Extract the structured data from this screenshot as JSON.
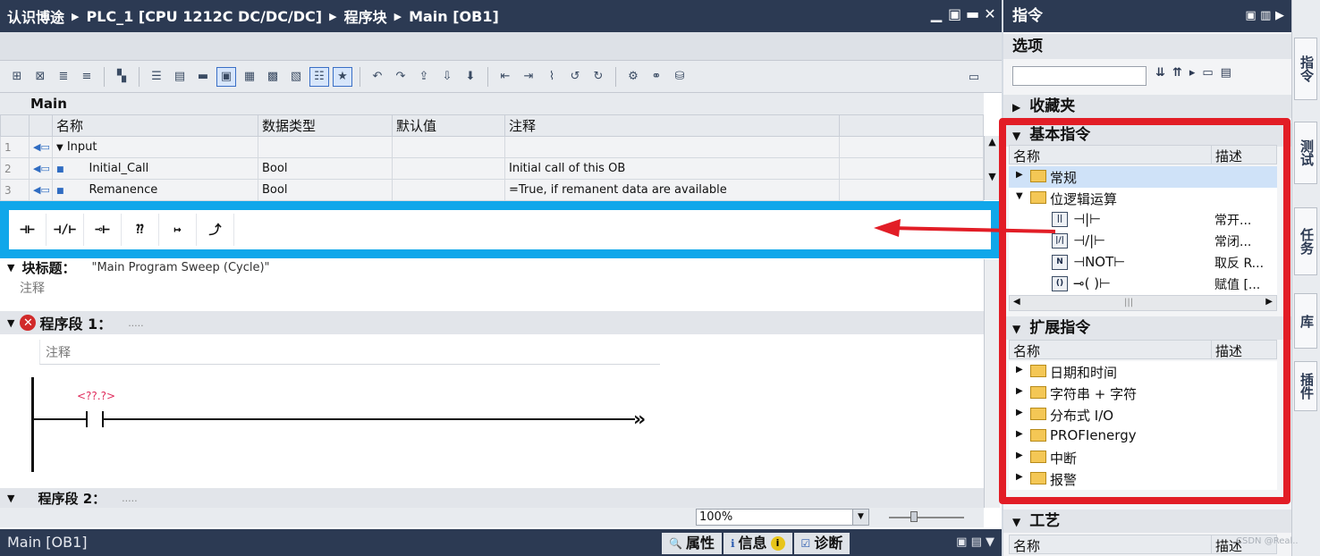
{
  "editor": {
    "breadcrumbs": [
      "认识博途",
      "PLC_1 [CPU 1212C DC/DC/DC]",
      "程序块",
      "Main [OB1]"
    ],
    "window_controls": [
      "▁",
      "▣",
      "▬",
      "✕"
    ]
  },
  "interface": {
    "title": "Main",
    "columns": [
      "名称",
      "数据类型",
      "默认值",
      "注释"
    ],
    "rows": [
      {
        "num": "1",
        "name": "Input",
        "type": "",
        "default": "",
        "comment": ""
      },
      {
        "num": "2",
        "name": "Initial_Call",
        "type": "Bool",
        "default": "",
        "comment": "Initial call of this OB"
      },
      {
        "num": "3",
        "name": "Remanence",
        "type": "Bool",
        "default": "",
        "comment": "=True, if remanent data are available"
      }
    ]
  },
  "quickbar": {
    "items": [
      "⊣⊢",
      "⊣/⊢",
      "⊸⊢",
      "⁇",
      "↦",
      "⤴"
    ]
  },
  "block": {
    "label": "块标题：",
    "title": "\"Main Program Sweep (Cycle)\"",
    "comment": "注释"
  },
  "network1": {
    "title": "程序段 1：",
    "dots": ".....",
    "comment": "注释",
    "operand": "<??.?>",
    "end_marker": "»",
    "error_icon": "✕"
  },
  "network2": {
    "title": "程序段 2：",
    "dots": "....."
  },
  "zoom": {
    "value": "100%"
  },
  "statusbar": {
    "label": "Main [OB1]",
    "tabs": [
      "属性",
      "信息",
      "诊断"
    ],
    "info_badge": "i"
  },
  "taskcard": {
    "header": "指令",
    "options_title": "选项",
    "search_placeholder": "",
    "favorites": "收藏夹",
    "basic": {
      "title": "基本指令",
      "col_name": "名称",
      "col_desc": "描述",
      "rows": [
        {
          "kind": "folder",
          "label": "常规",
          "desc": "",
          "selected": true
        },
        {
          "kind": "folder-open",
          "label": "位逻辑运算",
          "desc": ""
        },
        {
          "kind": "instr",
          "icon": "-||-",
          "label": "⊣|⊢",
          "desc": "常开..."
        },
        {
          "kind": "instr",
          "icon": "-|/|-",
          "label": "⊣/|⊢",
          "desc": "常闭..."
        },
        {
          "kind": "instr",
          "icon": "NOT",
          "label": "⊣NOT⊢",
          "desc": "取反 R..."
        },
        {
          "kind": "instr",
          "icon": "-( )-",
          "label": "⊸( )⊢",
          "desc": "赋值 [..."
        }
      ]
    },
    "extended": {
      "title": "扩展指令",
      "col_name": "名称",
      "col_desc": "描述",
      "rows": [
        "日期和时间",
        "字符串 + 字符",
        "分布式 I/O",
        "PROFIenergy",
        "中断",
        "报警"
      ]
    },
    "tech": {
      "title": "工艺",
      "col_name": "名称",
      "col_desc": "描述"
    }
  },
  "sidetabs": [
    "指令",
    "测试",
    "任务",
    "库",
    "插件"
  ],
  "watermark": "CSDN @Real..",
  "colors": {
    "titlebar": "#2c3a53",
    "blue_highlight": "#10a7ea",
    "red_highlight": "#e21d26",
    "error": "#d12a2a",
    "operand": "#e02c5c"
  }
}
